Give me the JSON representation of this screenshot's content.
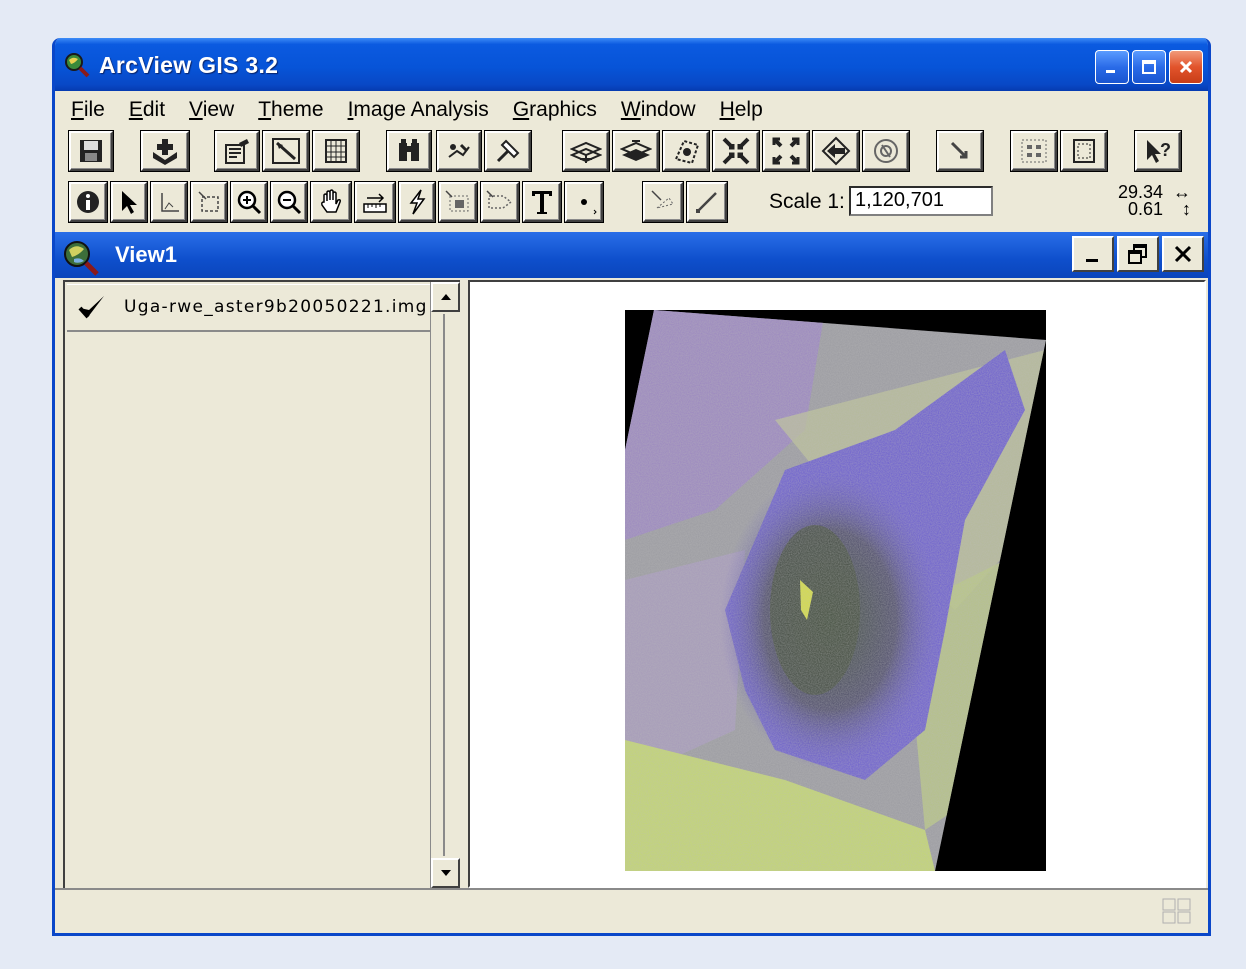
{
  "window": {
    "title": "ArcView GIS 3.2"
  },
  "menu": [
    {
      "label": "File",
      "key": "F",
      "rest": "ile"
    },
    {
      "label": "Edit",
      "key": "E",
      "rest": "dit"
    },
    {
      "label": "View",
      "key": "V",
      "rest": "iew"
    },
    {
      "label": "Theme",
      "key": "T",
      "rest": "heme"
    },
    {
      "label": "Image Analysis",
      "key": "I",
      "rest": "mage Analysis"
    },
    {
      "label": "Graphics",
      "key": "G",
      "rest": "raphics"
    },
    {
      "label": "Window",
      "key": "W",
      "rest": "indow"
    },
    {
      "label": "Help",
      "key": "H",
      "rest": "elp"
    }
  ],
  "toolbar2": {
    "scale_label": "Scale  1:",
    "scale_value": "1,120,701",
    "coord_x": "29.34",
    "coord_y": "0.61"
  },
  "view": {
    "title": "View1",
    "theme_name": "Uga-rwe_aster9b20050221.img",
    "theme_checked": true
  },
  "colors": {
    "title_blue": "#0754d8",
    "window_face": "#ece9d8",
    "close_red": "#e2542c"
  }
}
